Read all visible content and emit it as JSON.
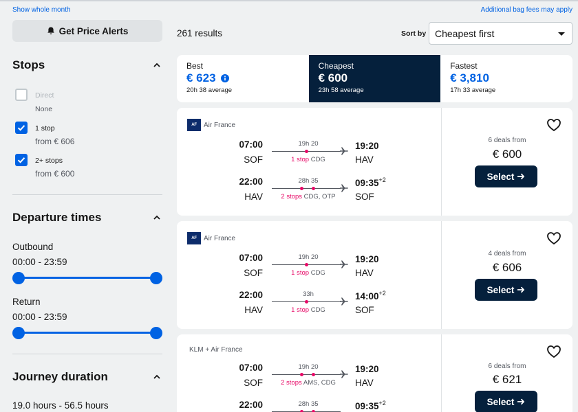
{
  "top_links": {
    "show_month": "Show whole month",
    "bag_fees": "Additional bag fees may apply"
  },
  "sidebar": {
    "price_alerts": "Get Price Alerts",
    "stops": {
      "title": "Stops",
      "options": [
        {
          "label": "Direct",
          "sub": "None",
          "checked": false
        },
        {
          "label": "1 stop",
          "sub": "from € 606",
          "checked": true
        },
        {
          "label": "2+ stops",
          "sub": "from € 600",
          "checked": true
        }
      ]
    },
    "departure": {
      "title": "Departure times",
      "outbound_label": "Outbound",
      "outbound_range": "00:00 - 23:59",
      "return_label": "Return",
      "return_range": "00:00 - 23:59"
    },
    "duration": {
      "title": "Journey duration",
      "range": "19.0 hours - 56.5 hours"
    }
  },
  "header": {
    "results": "261 results",
    "sort_label": "Sort by",
    "sort_value": "Cheapest first"
  },
  "tabs": [
    {
      "name": "Best",
      "price": "€ 623",
      "sub": "20h 38 average",
      "active": false
    },
    {
      "name": "Cheapest",
      "price": "€ 600",
      "sub": "23h 58 average",
      "active": true
    },
    {
      "name": "Fastest",
      "price": "€ 3,810",
      "sub": "17h 33 average",
      "active": false
    }
  ],
  "results": [
    {
      "airline": "Air France",
      "logo_text": "AF",
      "legs": [
        {
          "dep_time": "07:00",
          "dep_code": "SOF",
          "arr_time": "19:20",
          "arr_day": "",
          "arr_code": "HAV",
          "duration": "19h 20",
          "stops": "1 stop",
          "via": "CDG"
        },
        {
          "dep_time": "22:00",
          "dep_code": "HAV",
          "arr_time": "09:35",
          "arr_day": "+2",
          "arr_code": "SOF",
          "duration": "28h 35",
          "stops": "2 stops",
          "via": "CDG, OTP"
        }
      ],
      "deals": "6 deals from",
      "price": "€ 600",
      "select": "Select"
    },
    {
      "airline": "Air France",
      "logo_text": "AF",
      "legs": [
        {
          "dep_time": "07:00",
          "dep_code": "SOF",
          "arr_time": "19:20",
          "arr_day": "",
          "arr_code": "HAV",
          "duration": "19h 20",
          "stops": "1 stop",
          "via": "CDG"
        },
        {
          "dep_time": "22:00",
          "dep_code": "HAV",
          "arr_time": "14:00",
          "arr_day": "+2",
          "arr_code": "SOF",
          "duration": "33h",
          "stops": "1 stop",
          "via": "CDG"
        }
      ],
      "deals": "4 deals from",
      "price": "€ 606",
      "select": "Select"
    },
    {
      "airline": "KLM + Air France",
      "legs": [
        {
          "dep_time": "07:00",
          "dep_code": "SOF",
          "arr_time": "19:20",
          "arr_day": "",
          "arr_code": "HAV",
          "duration": "19h 20",
          "stops": "2 stops",
          "via": "AMS, CDG"
        },
        {
          "dep_time": "22:00",
          "dep_code": "",
          "arr_time": "09:35",
          "arr_day": "+2",
          "arr_code": "",
          "duration": "28h 35",
          "stops": "",
          "via": ""
        }
      ],
      "deals": "6 deals from",
      "price": "€ 621",
      "select": "Select"
    }
  ],
  "colors": {
    "accent": "#0062e3",
    "dark": "#05203c",
    "stop_pink": "#e70866",
    "background": "#eff1f2"
  }
}
